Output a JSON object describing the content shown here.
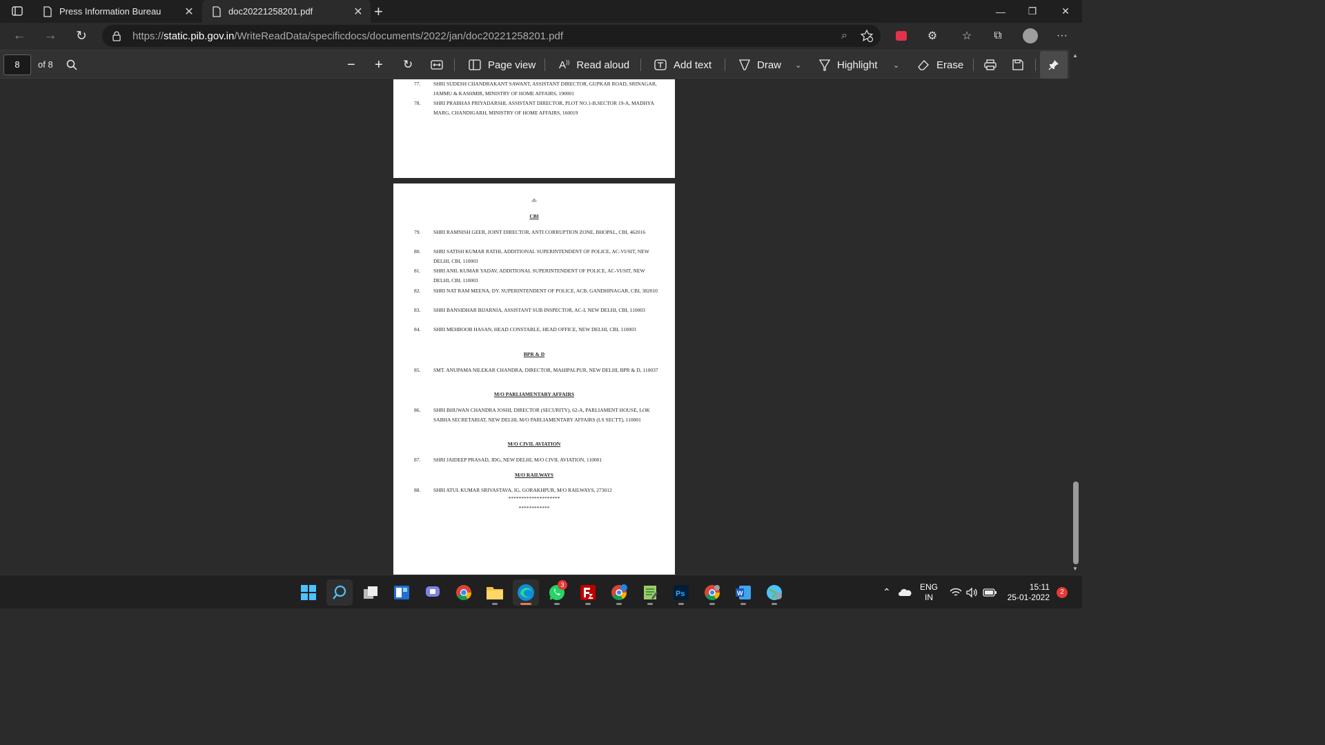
{
  "tabs": [
    {
      "label": "Press Information Bureau",
      "active": false
    },
    {
      "label": "doc20221258201.pdf",
      "active": true
    }
  ],
  "address": {
    "protocol": "https://",
    "host": "static.pib.gov.in",
    "path": "/WriteReadData/specificdocs/documents/2022/jan/doc20221258201.pdf"
  },
  "pdf_toolbar": {
    "page_number": "8",
    "of_pages": "of 8",
    "page_view": "Page view",
    "read_aloud": "Read aloud",
    "add_text": "Add text",
    "draw": "Draw",
    "highlight": "Highlight",
    "erase": "Erase"
  },
  "page1": {
    "entries": [
      {
        "num": "77.",
        "text": "SHRI SUDESH CHANDRAKANT SAWANT,   ASSISTANT DIRECTOR,  GUPKAR ROAD, SRINAGAR, JAMMU & KASHMIR,  MINISTRY OF HOME AFFAIRS, 190001"
      },
      {
        "num": "78.",
        "text": "SHRI PRABHAS PRIYADARSHI,  ASSISTANT DIRECTOR,  PLOT NO.1-B,SECTOR 19-A, MADHYA MARG, CHANDIGARH, MINISTRY OF HOME AFFAIRS, 160019"
      }
    ]
  },
  "page2": {
    "page_label": "-8-",
    "heading_cbi": "CBI",
    "cbi_entries": [
      {
        "num": "79.",
        "text": "SHRI RAMNISH GEER, JOINT DIRECTOR, ANTI CORRUPTION ZONE, BHOPAL,   CBI, 462016"
      },
      {
        "num": "80.",
        "text": "SHRI SATISH KUMAR RATHI,   ADDITIONAL SUPERINTENDENT OF POLICE,  AC-VI/SIT, NEW DELHI,  CBI, 110003"
      },
      {
        "num": "81.",
        "text": "SHRI ANIL KUMAR YADAV, ADDITIONAL SUPERINTENDENT OF POLICE, AC-VI/SIT, NEW DELHI,  CBI, 110003"
      },
      {
        "num": "82.",
        "text": "SHRI NAT RAM MEENA, DY. SUPERINTENDENT OF POLICE, ACB, GANDHINAGAR, CBI, 382010"
      },
      {
        "num": "83.",
        "text": "SHRI BANSIDHAR BIJARNIA,  ASSISTANT SUB INSPECTOR, AC-I, NEW DELHI,  CBI, 110003"
      },
      {
        "num": "84.",
        "text": "SHRI MEHBOOB HASAN,   HEAD CONSTABLE,  HEAD OFFICE, NEW DELHI,   CBI, 110003"
      }
    ],
    "heading_bprd": "BPR & D",
    "bprd_entries": [
      {
        "num": "85.",
        "text": "SMT. ANUPAMA NILEKAR CHANDRA,   DIRECTOR, MAHIPALPUR, NEW DELHI,  BPR & D, 110037"
      }
    ],
    "heading_parl": "M/O PARLIAMENTARY AFFAIRS",
    "parl_entries": [
      {
        "num": "86.",
        "text": "SHRI BHUWAN CHANDRA JOSHI,   DIRECTOR (SECURITY),  62-A, PARLIAMENT HOUSE, LOK SABHA SECRETARIAT, NEW DELHI,  M/O PARLIAMENTARY AFFAIRS (LS SECTT), 110001"
      }
    ],
    "heading_civil": "M/O CIVIL AVIATION",
    "civil_entries": [
      {
        "num": "87.",
        "text": "SHRI JAIDEEP PRASAD,  JDG,  NEW DELHI,  M/O CIVIL AVIATION,  110001"
      }
    ],
    "heading_rail": "M/O RAILWAYS",
    "rail_entries": [
      {
        "num": "88.",
        "text": "SHRI ATUL KUMAR SRIVASTAVA, IG,  GORAKHPUR, M/O RAILWAYS,  273012"
      }
    ],
    "stars1": "********************",
    "stars2": "************"
  },
  "taskbar": {
    "whatsapp_badge": "3",
    "lang_line1": "ENG",
    "lang_line2": "IN",
    "time": "15:11",
    "date": "25-01-2022",
    "notifications": "2"
  }
}
